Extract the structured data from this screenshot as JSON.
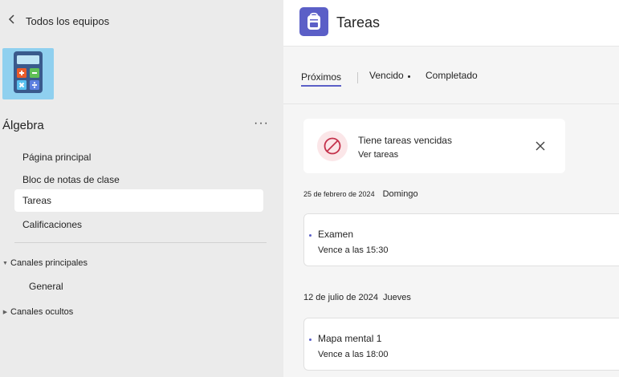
{
  "sidebar": {
    "back_label": "Todos los equipos",
    "team": {
      "name": "Álgebra",
      "more": "···"
    },
    "nav": [
      {
        "label": "Página principal"
      },
      {
        "label": "Bloc de notas de clase"
      },
      {
        "label": "Tareas",
        "active": true
      },
      {
        "label": "Calificaciones"
      }
    ],
    "channel_groups": [
      {
        "label": "Canales principales",
        "expanded": true,
        "channels": [
          "General"
        ]
      },
      {
        "label": "Canales ocultos",
        "expanded": false
      }
    ]
  },
  "header": {
    "title": "Tareas"
  },
  "tabs": [
    {
      "label": "Próximos",
      "active": true
    },
    {
      "label": "Vencido"
    },
    {
      "label": "Completado"
    }
  ],
  "alert": {
    "title": "Tiene tareas vencidas",
    "link": "Ver tareas"
  },
  "groups": [
    {
      "date": "25 de febrero de 2024",
      "day": "Domingo",
      "assignments": [
        {
          "title": "Examen",
          "due": "Vence a las 15:30"
        }
      ]
    },
    {
      "date": "12 de julio de 2024",
      "day": "Jueves",
      "assignments": [
        {
          "title": "Mapa mental 1",
          "due": "Vence a las 18:00"
        }
      ]
    }
  ],
  "colors": {
    "accent": "#5b5fc7",
    "team_tile": "#8fd0ef",
    "alert_icon": "#c4314b"
  }
}
